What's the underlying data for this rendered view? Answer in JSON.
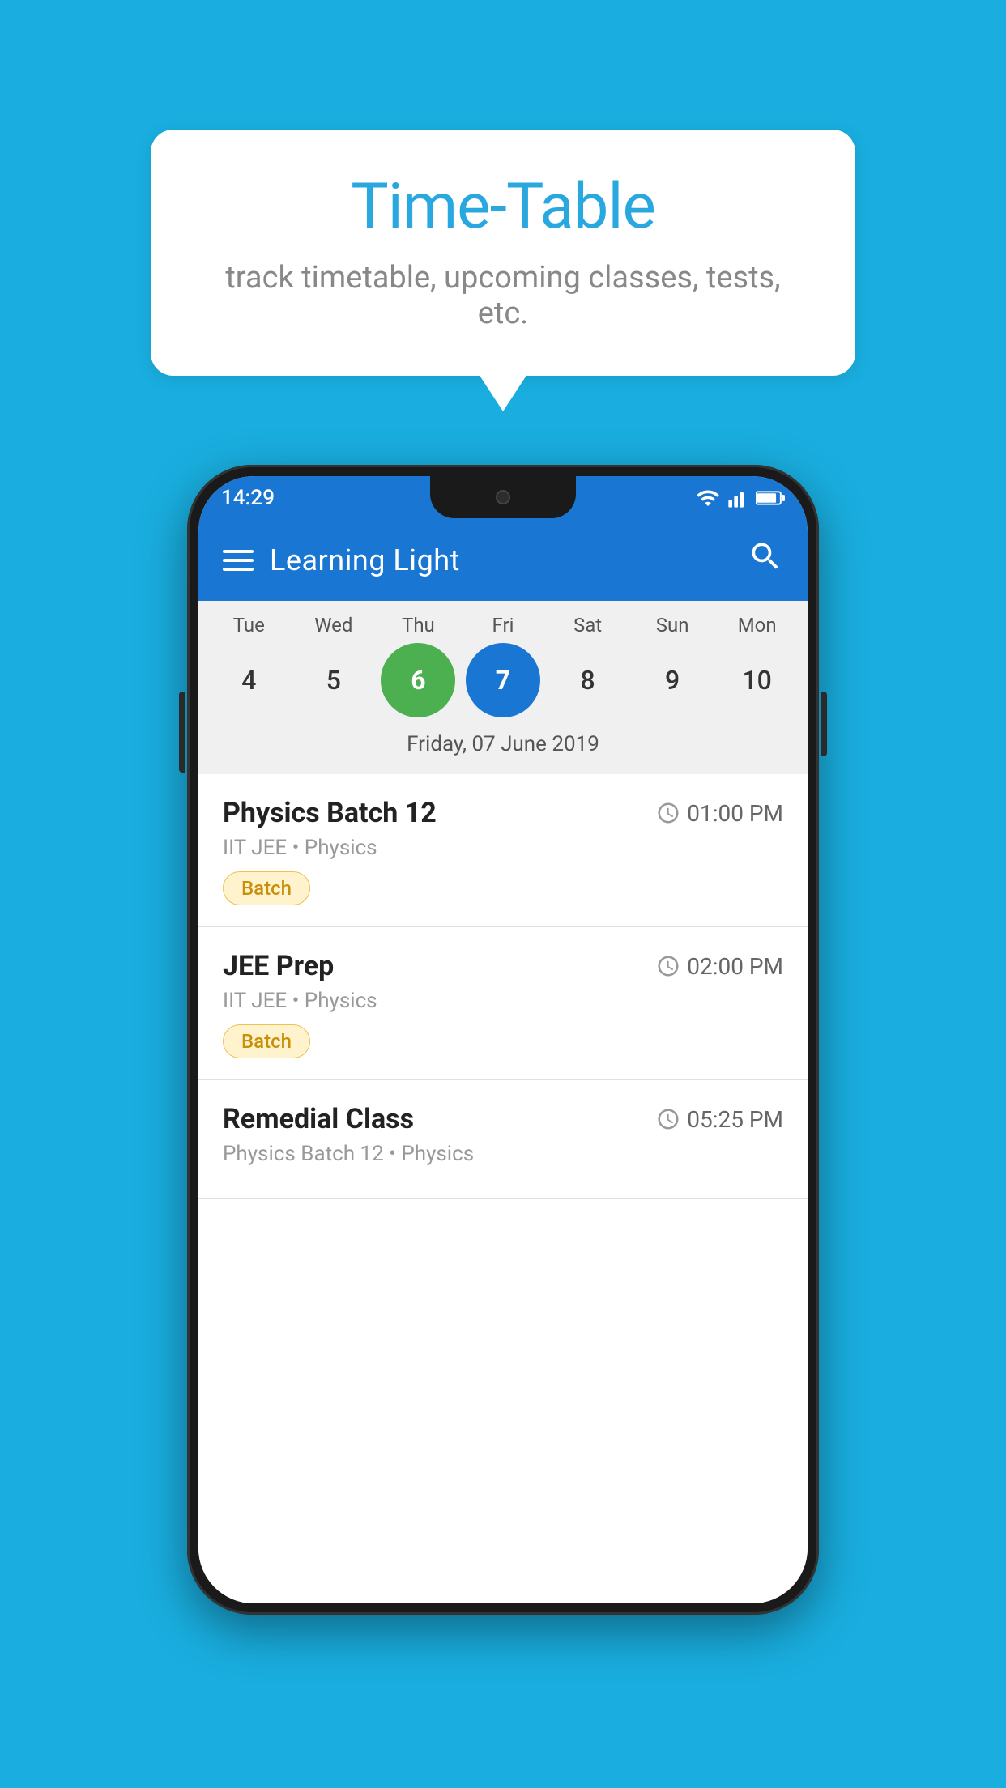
{
  "background_color": "#19AEDF",
  "speech_bubble": {
    "title": "Time-Table",
    "subtitle": "track timetable, upcoming classes, tests, etc."
  },
  "phone": {
    "status_bar": {
      "time": "14:29",
      "icons": [
        "wifi",
        "signal",
        "battery"
      ]
    },
    "app_bar": {
      "title": "Learning Light"
    },
    "calendar": {
      "days": [
        "Tue",
        "Wed",
        "Thu",
        "Fri",
        "Sat",
        "Sun",
        "Mon"
      ],
      "dates": [
        "4",
        "5",
        "6",
        "7",
        "8",
        "9",
        "10"
      ],
      "today_index": 2,
      "selected_index": 3,
      "selected_date_label": "Friday, 07 June 2019"
    },
    "schedule": [
      {
        "title": "Physics Batch 12",
        "time": "01:00 PM",
        "subtitle": "IIT JEE • Physics",
        "tag": "Batch"
      },
      {
        "title": "JEE Prep",
        "time": "02:00 PM",
        "subtitle": "IIT JEE • Physics",
        "tag": "Batch"
      },
      {
        "title": "Remedial Class",
        "time": "05:25 PM",
        "subtitle": "Physics Batch 12 • Physics",
        "tag": null
      }
    ]
  }
}
